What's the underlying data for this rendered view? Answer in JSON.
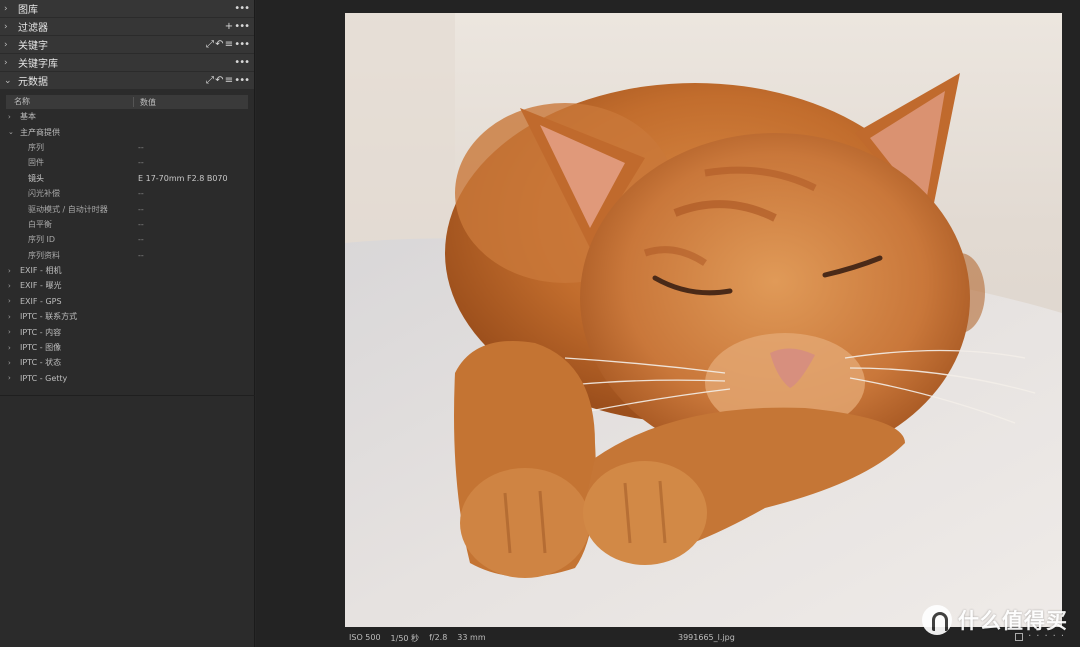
{
  "sidebar": {
    "sections": [
      {
        "title": "图库",
        "tools": "•••"
      },
      {
        "title": "过滤器",
        "tools": "+ •••"
      },
      {
        "title": "关键字",
        "tools": "⤢ ↶ ≡ •••"
      },
      {
        "title": "关键字库",
        "tools": "•••"
      },
      {
        "title": "元数据",
        "tools": "⤢ ↶ ≡ •••"
      }
    ],
    "metadata": {
      "col_name": "名称",
      "col_value": "数值",
      "groups_top": [
        "基本",
        "主产商提供"
      ],
      "vendor_rows": [
        {
          "name": "序列",
          "value": "--"
        },
        {
          "name": "固件",
          "value": "--"
        },
        {
          "name": "镜头",
          "value": "E 17-70mm F2.8 B070"
        },
        {
          "name": "闪光补偿",
          "value": "--"
        },
        {
          "name": "驱动模式 / 自动计时器",
          "value": "--"
        },
        {
          "name": "白平衡",
          "value": "--"
        },
        {
          "name": "序列 ID",
          "value": "--"
        },
        {
          "name": "序列资料",
          "value": "--"
        }
      ],
      "groups_bottom": [
        "EXIF - 相机",
        "EXIF - 曝光",
        "EXIF - GPS",
        "IPTC - 联系方式",
        "IPTC - 内容",
        "IPTC - 图像",
        "IPTC - 状态",
        "IPTC - Getty"
      ]
    }
  },
  "status": {
    "iso": "ISO 500",
    "shutter": "1/50 秒",
    "aperture": "f/2.8",
    "focal": "33 mm",
    "filename": "3991665_l.jpg"
  },
  "watermark": {
    "text": "什么值得买"
  },
  "colors": {
    "panel": "#2b2b2b",
    "header": "#363636",
    "viewer": "#232323",
    "cat_orange": "#c8732f"
  }
}
